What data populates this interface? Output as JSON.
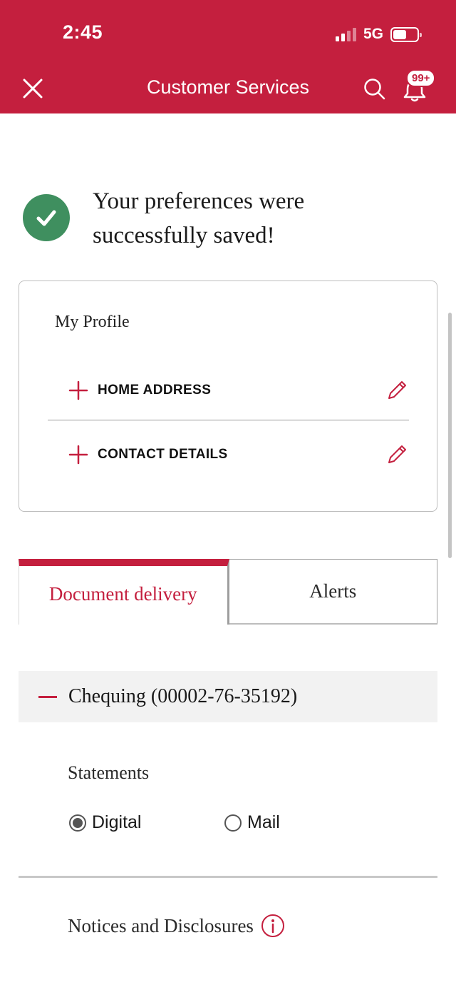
{
  "status_bar": {
    "time": "2:45",
    "network": "5G"
  },
  "header": {
    "title": "Customer Services",
    "badge": "99+",
    "icons": {
      "close": "close-icon",
      "search": "search-icon",
      "notifications": "bell-icon"
    }
  },
  "colors": {
    "brand": "#c41f3e",
    "success": "#3f8f5f",
    "panel": "#f2f2f2"
  },
  "success_message": {
    "text": "Your preferences were successfully saved!",
    "icon": "checkmark-icon"
  },
  "profile": {
    "title": "My Profile",
    "items": [
      {
        "label": "HOME ADDRESS",
        "expand_icon": "plus-icon",
        "edit_icon": "pencil-icon"
      },
      {
        "label": "CONTACT DETAILS",
        "expand_icon": "plus-icon",
        "edit_icon": "pencil-icon"
      }
    ]
  },
  "tabs": [
    {
      "label": "Document delivery",
      "active": true
    },
    {
      "label": "Alerts",
      "active": false
    }
  ],
  "account": {
    "label": "Chequing (00002-76-35192)",
    "collapse_icon": "minus-icon"
  },
  "statements": {
    "label": "Statements",
    "options": [
      {
        "label": "Digital",
        "selected": true
      },
      {
        "label": "Mail",
        "selected": false
      }
    ]
  },
  "notices": {
    "label": "Notices and Disclosures",
    "icon": "info-icon"
  }
}
